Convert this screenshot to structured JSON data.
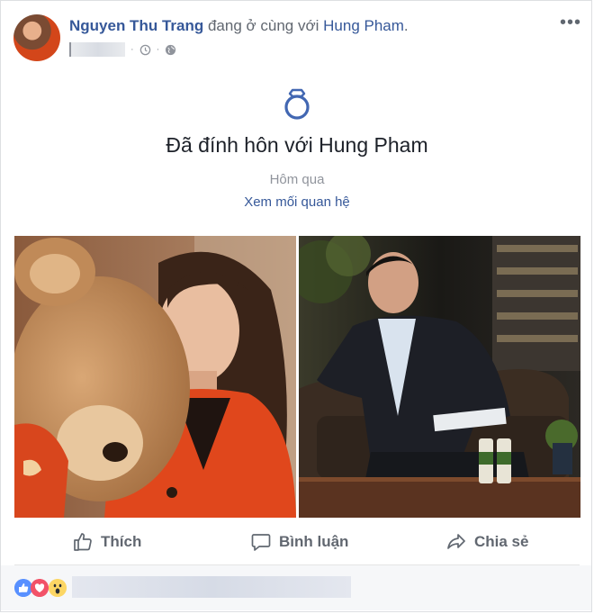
{
  "post": {
    "author": "Nguyen Thu Trang",
    "with_text": "đang ở cùng với",
    "tagged": "Hung Pham",
    "with_suffix": ".",
    "more_menu": "•••"
  },
  "life_event": {
    "title": "Đã đính hôn với Hung Pham",
    "date": "Hôm qua",
    "link": "Xem mối quan hệ"
  },
  "actions": {
    "like": "Thích",
    "comment": "Bình luận",
    "share": "Chia sẻ"
  },
  "icons": {
    "ring": "ring-icon",
    "clock": "clock-icon",
    "globe": "globe-icon",
    "like": "thumbs-up-icon",
    "comment": "comment-bubble-icon",
    "share": "share-arrow-icon"
  },
  "colors": {
    "link": "#365899",
    "muted": "#90949c",
    "ring": "#4267b2"
  }
}
